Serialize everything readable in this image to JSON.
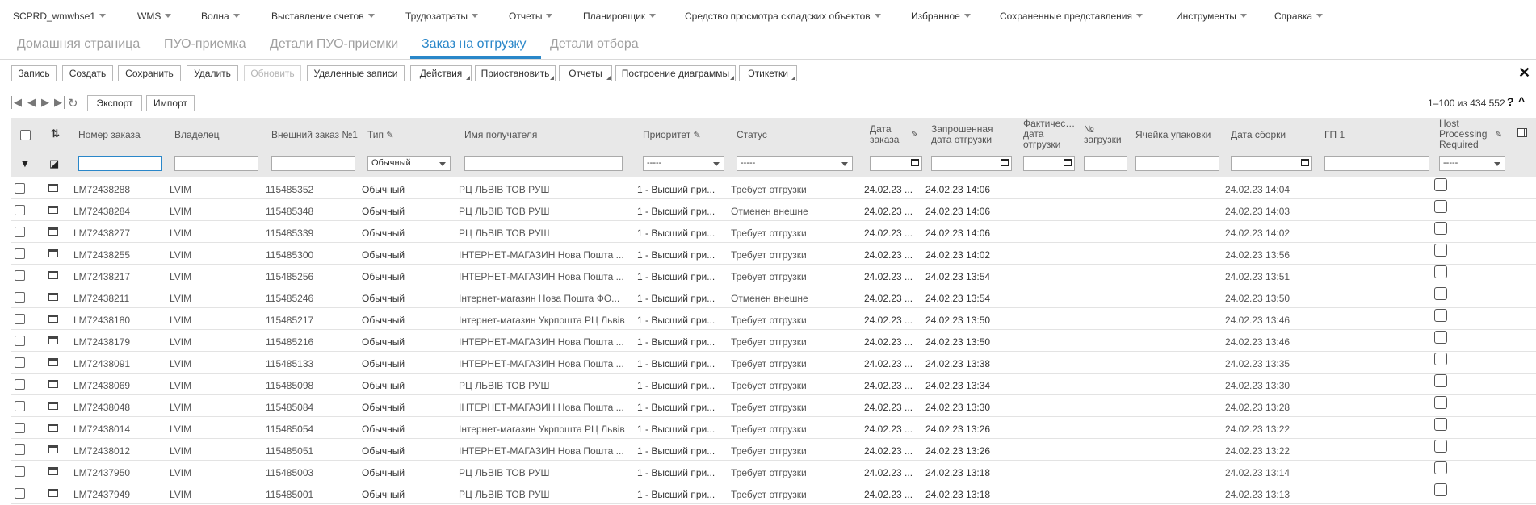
{
  "menu": [
    {
      "label": "SCPRD_wmwhse1"
    },
    {
      "label": "WMS"
    },
    {
      "label": "Волна"
    },
    {
      "label": "Выставление счетов"
    },
    {
      "label": "Трудозатраты"
    },
    {
      "label": "Отчеты"
    },
    {
      "label": "Планировщик"
    },
    {
      "label": "Средство просмотра складских объектов"
    },
    {
      "label": "Избранное"
    },
    {
      "label": "Сохраненные представления"
    },
    {
      "label": "Инструменты"
    },
    {
      "label": "Справка"
    }
  ],
  "tabs": [
    {
      "label": "Домашняя страница"
    },
    {
      "label": "ПУО-приемка"
    },
    {
      "label": "Детали ПУО-приемки"
    },
    {
      "label": "Заказ на отгрузку"
    },
    {
      "label": "Детали отбора"
    }
  ],
  "toolbar": {
    "buttons": [
      {
        "label": "Запись"
      },
      {
        "label": "Создать"
      },
      {
        "label": "Сохранить"
      },
      {
        "label": "Удалить"
      },
      {
        "label": "Обновить"
      },
      {
        "label": "Удаленные записи"
      },
      {
        "label": "Действия"
      },
      {
        "label": "Приостановить"
      },
      {
        "label": "Отчеты"
      },
      {
        "label": "Построение диаграммы"
      },
      {
        "label": "Этикетки"
      }
    ],
    "close_icon": "✕"
  },
  "pager": {
    "export_label": "Экспорт",
    "import_label": "Импорт",
    "info": "1–100 из 434 552",
    "help": "?",
    "collapse": "^"
  },
  "grid": {
    "headers": {
      "order_no": "Номер заказа",
      "owner": "Владелец",
      "ext_order": "Внешний заказ №1",
      "type": "Тип",
      "recipient": "Имя получателя",
      "priority": "Приоритет",
      "status": "Статус",
      "order_date_1": "Дата",
      "order_date_2": "заказа",
      "req_ship_1": "Запрошенная",
      "req_ship_2": "дата отгрузки",
      "act_ship_1": "Фактичес…",
      "act_ship_2": "дата",
      "act_ship_3": "отгрузки",
      "load_1": "№",
      "load_2": "загрузки",
      "pack_cell": "Ячейка упаковки",
      "pick_date": "Дата сборки",
      "gp1": "ГП 1",
      "host_1": "Host",
      "host_2": "Processing",
      "host_3": "Required"
    },
    "filters": {
      "type_value": "Обычный",
      "priority_value": "-----",
      "status_value": "-----",
      "host_value": "-----"
    },
    "rows": [
      {
        "order": "LM72438288",
        "owner": "LVIM",
        "ext": "115485352",
        "type": "Обычный",
        "recipient": "РЦ ЛЬВІВ ТОВ РУШ",
        "priority": "1 - Высший при...",
        "status": "Требует отгрузки",
        "order_date": "24.02.23 ...",
        "req_date": "24.02.23 14:06",
        "pick_date": "24.02.23 14:04"
      },
      {
        "order": "LM72438284",
        "owner": "LVIM",
        "ext": "115485348",
        "type": "Обычный",
        "recipient": "РЦ ЛЬВІВ ТОВ РУШ",
        "priority": "1 - Высший при...",
        "status": "Отменен внешне",
        "order_date": "24.02.23 ...",
        "req_date": "24.02.23 14:06",
        "pick_date": "24.02.23 14:03"
      },
      {
        "order": "LM72438277",
        "owner": "LVIM",
        "ext": "115485339",
        "type": "Обычный",
        "recipient": "РЦ ЛЬВІВ ТОВ РУШ",
        "priority": "1 - Высший при...",
        "status": "Требует отгрузки",
        "order_date": "24.02.23 ...",
        "req_date": "24.02.23 14:06",
        "pick_date": "24.02.23 14:02"
      },
      {
        "order": "LM72438255",
        "owner": "LVIM",
        "ext": "115485300",
        "type": "Обычный",
        "recipient": "ІНТЕРНЕТ-МАГАЗИН Нова Пошта ...",
        "priority": "1 - Высший при...",
        "status": "Требует отгрузки",
        "order_date": "24.02.23 ...",
        "req_date": "24.02.23 14:02",
        "pick_date": "24.02.23 13:56"
      },
      {
        "order": "LM72438217",
        "owner": "LVIM",
        "ext": "115485256",
        "type": "Обычный",
        "recipient": "ІНТЕРНЕТ-МАГАЗИН Нова Пошта ...",
        "priority": "1 - Высший при...",
        "status": "Требует отгрузки",
        "order_date": "24.02.23 ...",
        "req_date": "24.02.23 13:54",
        "pick_date": "24.02.23 13:51"
      },
      {
        "order": "LM72438211",
        "owner": "LVIM",
        "ext": "115485246",
        "type": "Обычный",
        "recipient": "Інтернет-магазин Нова Пошта ФО...",
        "priority": "1 - Высший при...",
        "status": "Отменен внешне",
        "order_date": "24.02.23 ...",
        "req_date": "24.02.23 13:54",
        "pick_date": "24.02.23 13:50"
      },
      {
        "order": "LM72438180",
        "owner": "LVIM",
        "ext": "115485217",
        "type": "Обычный",
        "recipient": "Інтернет-магазин Укрпошта РЦ Львів",
        "priority": "1 - Высший при...",
        "status": "Требует отгрузки",
        "order_date": "24.02.23 ...",
        "req_date": "24.02.23 13:50",
        "pick_date": "24.02.23 13:46"
      },
      {
        "order": "LM72438179",
        "owner": "LVIM",
        "ext": "115485216",
        "type": "Обычный",
        "recipient": "ІНТЕРНЕТ-МАГАЗИН Нова Пошта ...",
        "priority": "1 - Высший при...",
        "status": "Требует отгрузки",
        "order_date": "24.02.23 ...",
        "req_date": "24.02.23 13:50",
        "pick_date": "24.02.23 13:46"
      },
      {
        "order": "LM72438091",
        "owner": "LVIM",
        "ext": "115485133",
        "type": "Обычный",
        "recipient": "ІНТЕРНЕТ-МАГАЗИН Нова Пошта ...",
        "priority": "1 - Высший при...",
        "status": "Требует отгрузки",
        "order_date": "24.02.23 ...",
        "req_date": "24.02.23 13:38",
        "pick_date": "24.02.23 13:35"
      },
      {
        "order": "LM72438069",
        "owner": "LVIM",
        "ext": "115485098",
        "type": "Обычный",
        "recipient": "РЦ ЛЬВІВ ТОВ РУШ",
        "priority": "1 - Высший при...",
        "status": "Требует отгрузки",
        "order_date": "24.02.23 ...",
        "req_date": "24.02.23 13:34",
        "pick_date": "24.02.23 13:30"
      },
      {
        "order": "LM72438048",
        "owner": "LVIM",
        "ext": "115485084",
        "type": "Обычный",
        "recipient": "ІНТЕРНЕТ-МАГАЗИН Нова Пошта ...",
        "priority": "1 - Высший при...",
        "status": "Требует отгрузки",
        "order_date": "24.02.23 ...",
        "req_date": "24.02.23 13:30",
        "pick_date": "24.02.23 13:28"
      },
      {
        "order": "LM72438014",
        "owner": "LVIM",
        "ext": "115485054",
        "type": "Обычный",
        "recipient": "Інтернет-магазин Укрпошта РЦ Львів",
        "priority": "1 - Высший при...",
        "status": "Требует отгрузки",
        "order_date": "24.02.23 ...",
        "req_date": "24.02.23 13:26",
        "pick_date": "24.02.23 13:22"
      },
      {
        "order": "LM72438012",
        "owner": "LVIM",
        "ext": "115485051",
        "type": "Обычный",
        "recipient": "ІНТЕРНЕТ-МАГАЗИН Нова Пошта ...",
        "priority": "1 - Высший при...",
        "status": "Требует отгрузки",
        "order_date": "24.02.23 ...",
        "req_date": "24.02.23 13:26",
        "pick_date": "24.02.23 13:22"
      },
      {
        "order": "LM72437950",
        "owner": "LVIM",
        "ext": "115485003",
        "type": "Обычный",
        "recipient": "РЦ ЛЬВІВ ТОВ РУШ",
        "priority": "1 - Высший при...",
        "status": "Требует отгрузки",
        "order_date": "24.02.23 ...",
        "req_date": "24.02.23 13:18",
        "pick_date": "24.02.23 13:14"
      },
      {
        "order": "LM72437949",
        "owner": "LVIM",
        "ext": "115485001",
        "type": "Обычный",
        "recipient": "РЦ ЛЬВІВ ТОВ РУШ",
        "priority": "1 - Высший при...",
        "status": "Требует отгрузки",
        "order_date": "24.02.23 ...",
        "req_date": "24.02.23 13:18",
        "pick_date": "24.02.23 13:13"
      }
    ]
  },
  "colors": {
    "accent": "#2a87c9",
    "header_bg": "#e8e8e8"
  }
}
